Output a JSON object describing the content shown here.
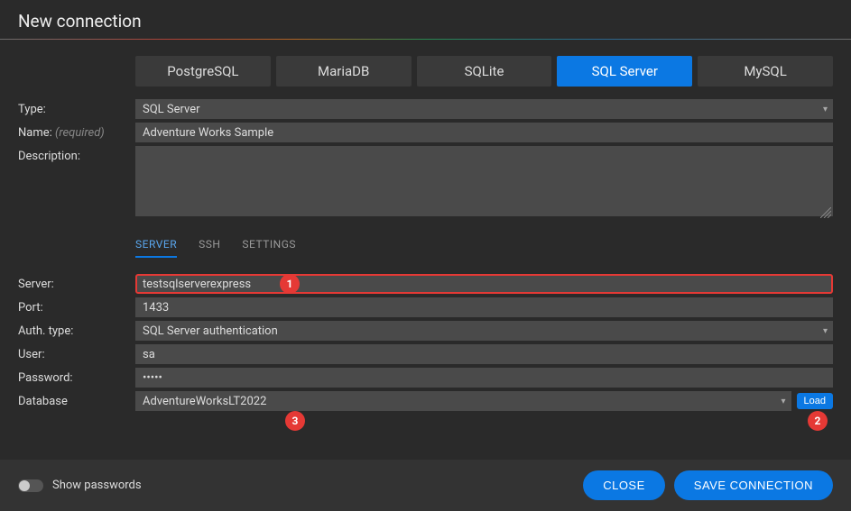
{
  "header": {
    "title": "New connection"
  },
  "dbTabs": [
    {
      "label": "PostgreSQL",
      "active": false
    },
    {
      "label": "MariaDB",
      "active": false
    },
    {
      "label": "SQLite",
      "active": false
    },
    {
      "label": "SQL Server",
      "active": true
    },
    {
      "label": "MySQL",
      "active": false
    }
  ],
  "form": {
    "type_label": "Type:",
    "type_value": "SQL Server",
    "name_label": "Name:",
    "name_hint": "(required)",
    "name_value": "Adventure Works Sample",
    "description_label": "Description:",
    "description_value": ""
  },
  "subTabs": [
    {
      "label": "SERVER",
      "active": true
    },
    {
      "label": "SSH",
      "active": false
    },
    {
      "label": "SETTINGS",
      "active": false
    }
  ],
  "serverForm": {
    "server_label": "Server:",
    "server_value": "testsqlserverexpress",
    "port_label": "Port:",
    "port_value": "1433",
    "authtype_label": "Auth. type:",
    "authtype_value": "SQL Server authentication",
    "user_label": "User:",
    "user_value": "sa",
    "password_label": "Password:",
    "password_value": "•••••",
    "database_label": "Database",
    "database_value": "AdventureWorksLT2022",
    "load_label": "Load"
  },
  "callouts": {
    "c1": "1",
    "c2": "2",
    "c3": "3"
  },
  "footer": {
    "show_passwords_label": "Show passwords",
    "close_label": "CLOSE",
    "save_label": "SAVE CONNECTION"
  }
}
